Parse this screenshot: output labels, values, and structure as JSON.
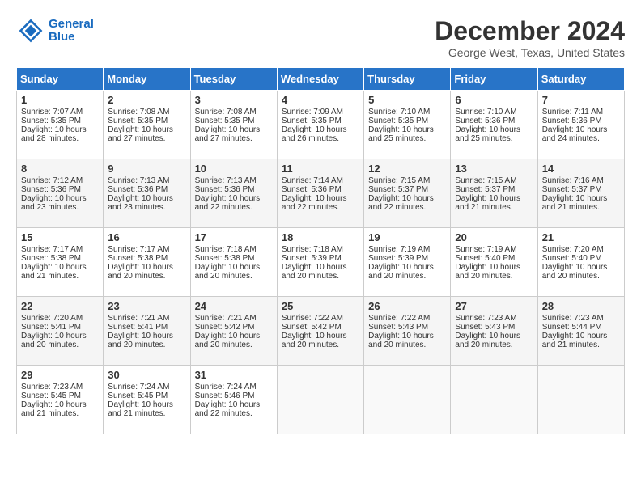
{
  "header": {
    "logo_line1": "General",
    "logo_line2": "Blue",
    "month": "December 2024",
    "location": "George West, Texas, United States"
  },
  "days_of_week": [
    "Sunday",
    "Monday",
    "Tuesday",
    "Wednesday",
    "Thursday",
    "Friday",
    "Saturday"
  ],
  "weeks": [
    [
      {
        "day": "1",
        "lines": [
          "Sunrise: 7:07 AM",
          "Sunset: 5:35 PM",
          "Daylight: 10 hours",
          "and 28 minutes."
        ]
      },
      {
        "day": "2",
        "lines": [
          "Sunrise: 7:08 AM",
          "Sunset: 5:35 PM",
          "Daylight: 10 hours",
          "and 27 minutes."
        ]
      },
      {
        "day": "3",
        "lines": [
          "Sunrise: 7:08 AM",
          "Sunset: 5:35 PM",
          "Daylight: 10 hours",
          "and 27 minutes."
        ]
      },
      {
        "day": "4",
        "lines": [
          "Sunrise: 7:09 AM",
          "Sunset: 5:35 PM",
          "Daylight: 10 hours",
          "and 26 minutes."
        ]
      },
      {
        "day": "5",
        "lines": [
          "Sunrise: 7:10 AM",
          "Sunset: 5:35 PM",
          "Daylight: 10 hours",
          "and 25 minutes."
        ]
      },
      {
        "day": "6",
        "lines": [
          "Sunrise: 7:10 AM",
          "Sunset: 5:36 PM",
          "Daylight: 10 hours",
          "and 25 minutes."
        ]
      },
      {
        "day": "7",
        "lines": [
          "Sunrise: 7:11 AM",
          "Sunset: 5:36 PM",
          "Daylight: 10 hours",
          "and 24 minutes."
        ]
      }
    ],
    [
      {
        "day": "8",
        "lines": [
          "Sunrise: 7:12 AM",
          "Sunset: 5:36 PM",
          "Daylight: 10 hours",
          "and 23 minutes."
        ]
      },
      {
        "day": "9",
        "lines": [
          "Sunrise: 7:13 AM",
          "Sunset: 5:36 PM",
          "Daylight: 10 hours",
          "and 23 minutes."
        ]
      },
      {
        "day": "10",
        "lines": [
          "Sunrise: 7:13 AM",
          "Sunset: 5:36 PM",
          "Daylight: 10 hours",
          "and 22 minutes."
        ]
      },
      {
        "day": "11",
        "lines": [
          "Sunrise: 7:14 AM",
          "Sunset: 5:36 PM",
          "Daylight: 10 hours",
          "and 22 minutes."
        ]
      },
      {
        "day": "12",
        "lines": [
          "Sunrise: 7:15 AM",
          "Sunset: 5:37 PM",
          "Daylight: 10 hours",
          "and 22 minutes."
        ]
      },
      {
        "day": "13",
        "lines": [
          "Sunrise: 7:15 AM",
          "Sunset: 5:37 PM",
          "Daylight: 10 hours",
          "and 21 minutes."
        ]
      },
      {
        "day": "14",
        "lines": [
          "Sunrise: 7:16 AM",
          "Sunset: 5:37 PM",
          "Daylight: 10 hours",
          "and 21 minutes."
        ]
      }
    ],
    [
      {
        "day": "15",
        "lines": [
          "Sunrise: 7:17 AM",
          "Sunset: 5:38 PM",
          "Daylight: 10 hours",
          "and 21 minutes."
        ]
      },
      {
        "day": "16",
        "lines": [
          "Sunrise: 7:17 AM",
          "Sunset: 5:38 PM",
          "Daylight: 10 hours",
          "and 20 minutes."
        ]
      },
      {
        "day": "17",
        "lines": [
          "Sunrise: 7:18 AM",
          "Sunset: 5:38 PM",
          "Daylight: 10 hours",
          "and 20 minutes."
        ]
      },
      {
        "day": "18",
        "lines": [
          "Sunrise: 7:18 AM",
          "Sunset: 5:39 PM",
          "Daylight: 10 hours",
          "and 20 minutes."
        ]
      },
      {
        "day": "19",
        "lines": [
          "Sunrise: 7:19 AM",
          "Sunset: 5:39 PM",
          "Daylight: 10 hours",
          "and 20 minutes."
        ]
      },
      {
        "day": "20",
        "lines": [
          "Sunrise: 7:19 AM",
          "Sunset: 5:40 PM",
          "Daylight: 10 hours",
          "and 20 minutes."
        ]
      },
      {
        "day": "21",
        "lines": [
          "Sunrise: 7:20 AM",
          "Sunset: 5:40 PM",
          "Daylight: 10 hours",
          "and 20 minutes."
        ]
      }
    ],
    [
      {
        "day": "22",
        "lines": [
          "Sunrise: 7:20 AM",
          "Sunset: 5:41 PM",
          "Daylight: 10 hours",
          "and 20 minutes."
        ]
      },
      {
        "day": "23",
        "lines": [
          "Sunrise: 7:21 AM",
          "Sunset: 5:41 PM",
          "Daylight: 10 hours",
          "and 20 minutes."
        ]
      },
      {
        "day": "24",
        "lines": [
          "Sunrise: 7:21 AM",
          "Sunset: 5:42 PM",
          "Daylight: 10 hours",
          "and 20 minutes."
        ]
      },
      {
        "day": "25",
        "lines": [
          "Sunrise: 7:22 AM",
          "Sunset: 5:42 PM",
          "Daylight: 10 hours",
          "and 20 minutes."
        ]
      },
      {
        "day": "26",
        "lines": [
          "Sunrise: 7:22 AM",
          "Sunset: 5:43 PM",
          "Daylight: 10 hours",
          "and 20 minutes."
        ]
      },
      {
        "day": "27",
        "lines": [
          "Sunrise: 7:23 AM",
          "Sunset: 5:43 PM",
          "Daylight: 10 hours",
          "and 20 minutes."
        ]
      },
      {
        "day": "28",
        "lines": [
          "Sunrise: 7:23 AM",
          "Sunset: 5:44 PM",
          "Daylight: 10 hours",
          "and 21 minutes."
        ]
      }
    ],
    [
      {
        "day": "29",
        "lines": [
          "Sunrise: 7:23 AM",
          "Sunset: 5:45 PM",
          "Daylight: 10 hours",
          "and 21 minutes."
        ]
      },
      {
        "day": "30",
        "lines": [
          "Sunrise: 7:24 AM",
          "Sunset: 5:45 PM",
          "Daylight: 10 hours",
          "and 21 minutes."
        ]
      },
      {
        "day": "31",
        "lines": [
          "Sunrise: 7:24 AM",
          "Sunset: 5:46 PM",
          "Daylight: 10 hours",
          "and 22 minutes."
        ]
      },
      null,
      null,
      null,
      null
    ]
  ]
}
